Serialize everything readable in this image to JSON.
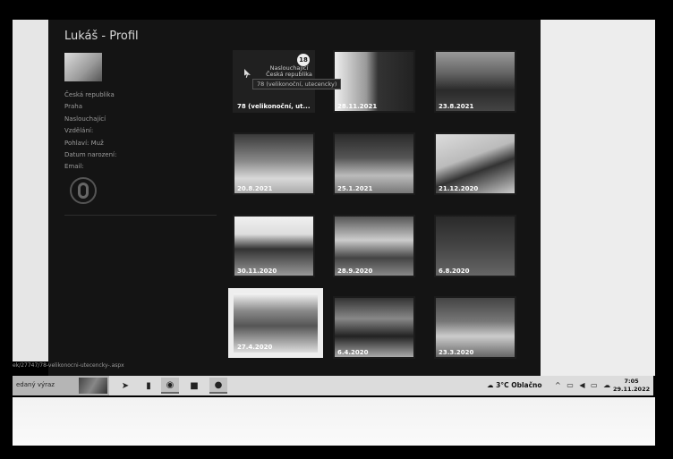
{
  "profile": {
    "title": "Lukáš - Profil",
    "info": [
      "Česká republika",
      "Praha",
      "Naslouchající",
      "Vzdělání:",
      "Pohlaví: Muž",
      "Datum narození:",
      "Email:"
    ]
  },
  "gallery": {
    "first": {
      "count": "18",
      "label": "78 (velikonoční, ut...",
      "hover_title": "Naslouchající\nČeská republika",
      "tooltip": "78 (velikonoční, utecencky)"
    },
    "dates": [
      "28.11.2021",
      "23.8.2021",
      "20.8.2021",
      "25.1.2021",
      "21.12.2020",
      "30.11.2020",
      "28.9.2020",
      "6.8.2020",
      "27.4.2020",
      "6.4.2020",
      "23.3.2020"
    ]
  },
  "statusbar": {
    "url": "ek/27747/78-velikonocni-utecencky-.aspx"
  },
  "taskbar": {
    "search_text": "edaný výraz",
    "weather": "3°C  Oblačno",
    "time": "7:05",
    "date": "29.11.2022"
  },
  "colors": {
    "app_bg": "#141414",
    "taskbar_bg": "#dcdcdc",
    "wall": "#ededed"
  }
}
